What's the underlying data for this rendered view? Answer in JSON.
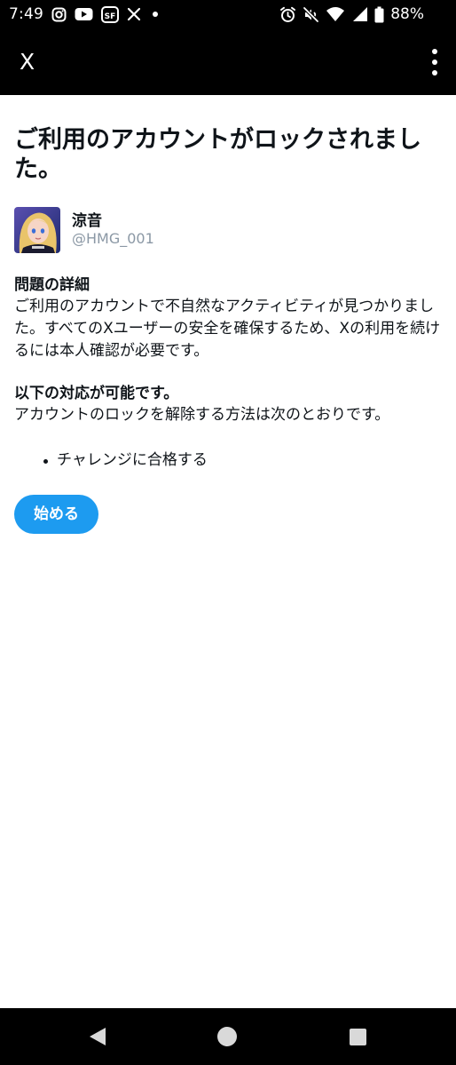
{
  "status_bar": {
    "time": "7:49",
    "battery": "88%",
    "left_icons": [
      "instagram-icon",
      "youtube-icon",
      "sf-app-icon",
      "x-logo-icon",
      "dot-icon"
    ],
    "right_icons": [
      "alarm-icon",
      "mute-icon",
      "wifi-icon",
      "signal-icon",
      "battery-icon"
    ]
  },
  "app_bar": {
    "title": "X",
    "menu_icon": "overflow-menu-icon"
  },
  "page": {
    "title": "ご利用のアカウントがロックされました。",
    "profile": {
      "name": "涼音",
      "handle": "@HMG_001"
    },
    "details_heading": "問題の詳細",
    "details_body": "ご利用のアカウントで不自然なアクティビティが見つかりました。すべてのXユーザーの安全を確保するため、Xの利用を続けるには本人確認が必要です。",
    "options_heading": "以下の対応が可能です。",
    "options_body": "アカウントのロックを解除する方法は次のとおりです。",
    "options": [
      "チャレンジに合格する"
    ],
    "start_button": "始める"
  },
  "colors": {
    "accent": "#1d9bf0",
    "text": "#0f1419",
    "secondary_text": "#8b98a5",
    "bar_background": "#000000"
  },
  "nav_bar": {
    "icons": [
      "back-icon",
      "home-icon",
      "recents-icon"
    ]
  }
}
